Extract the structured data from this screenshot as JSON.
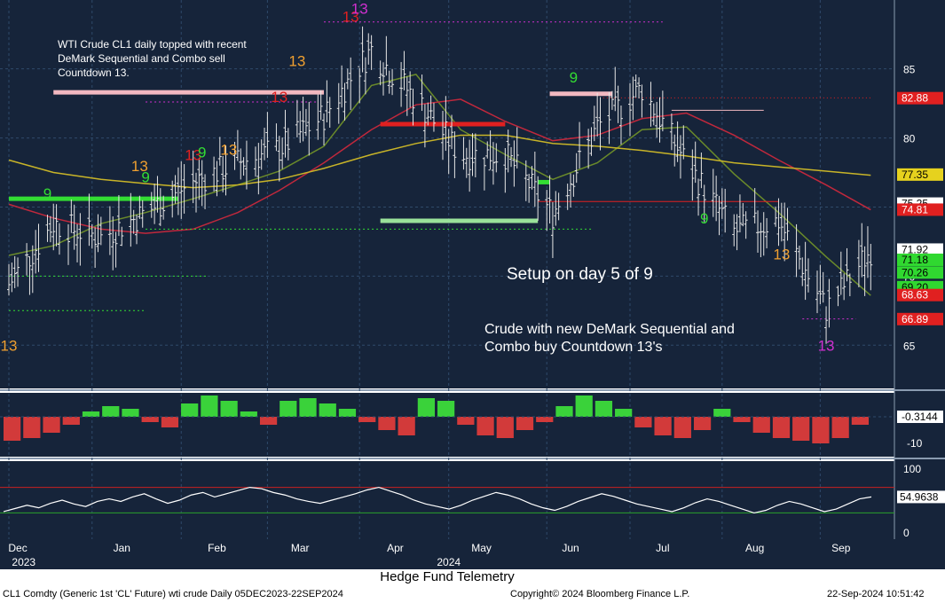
{
  "colors": {
    "panel_bg": "#16243a",
    "grid": "#2f4a6a",
    "price_bar": "#e6e6e6",
    "setup_buy": "#33dd33",
    "setup_sell": "#e02020",
    "countdown": "#f0a030",
    "magenta": "#d030d0",
    "ma_short": "#6a8a2a",
    "ma_mid": "#c0283c",
    "ma_long": "#c8b428",
    "osc_pos": "#3ad23a",
    "osc_neg": "#d23a3a",
    "rsi_line": "#ffffff",
    "rsi_top": "#c82020",
    "rsi_bottom": "#2aa02a"
  },
  "chart_data": [
    {
      "type": "candlestick",
      "title": "WTI Crude CL1 daily",
      "x_range": [
        "2023-12-05",
        "2024-09-22"
      ],
      "x_ticks": [
        "Dec",
        "Jan",
        "Feb",
        "Mar",
        "Apr",
        "May",
        "Jun",
        "Jul",
        "Aug",
        "Sep"
      ],
      "x_years": [
        "2023",
        "2024"
      ],
      "y_ticks": [
        65,
        70,
        75,
        80,
        85
      ],
      "ylim": [
        62.0,
        89.6
      ],
      "series": [
        {
          "name": "close",
          "x": [
            "2023-12-05",
            "2023-12-20",
            "2024-01-05",
            "2024-01-20",
            "2024-02-05",
            "2024-02-20",
            "2024-03-05",
            "2024-03-20",
            "2024-04-05",
            "2024-04-20",
            "2024-05-05",
            "2024-05-20",
            "2024-06-05",
            "2024-06-20",
            "2024-07-05",
            "2024-07-20",
            "2024-08-05",
            "2024-08-20",
            "2024-09-05",
            "2024-09-20"
          ],
          "values": [
            69.4,
            73.8,
            72.8,
            74.6,
            76.8,
            78.2,
            79.2,
            81.6,
            86.4,
            82.8,
            78.8,
            78.8,
            74.5,
            80.8,
            83.6,
            78.2,
            73.2,
            74.0,
            67.6,
            71.9
          ]
        }
      ],
      "price_labels": [
        {
          "value": 82.88,
          "label": "82.88",
          "color": "#e02020"
        },
        {
          "value": 77.35,
          "label": "77.35",
          "color": "#e6d21e"
        },
        {
          "value": 75.25,
          "label": "75.25",
          "color": "#ffffff"
        },
        {
          "value": 74.81,
          "label": "74.81",
          "color": "#e02020"
        },
        {
          "value": 71.92,
          "label": "71.92",
          "color": "#ffffff"
        },
        {
          "value": 71.18,
          "label": "71.18",
          "color": "#30d830"
        },
        {
          "value": 70.26,
          "label": "70.26",
          "color": "#30d830"
        },
        {
          "value": 69.2,
          "label": "69.20",
          "color": "#30d830"
        },
        {
          "value": 68.63,
          "label": "68.63",
          "color": "#e02020"
        },
        {
          "value": 66.89,
          "label": "66.89",
          "color": "#e02020"
        }
      ],
      "annotations": [
        "WTI Crude CL1 daily topped with recent",
        "DeMark Sequential and Combo sell",
        "Countdown 13.",
        "Setup on day 5 of 9",
        "Crude with new DeMark Sequential and",
        "Combo buy Countdown 13's"
      ],
      "demark_marks": [
        {
          "date": "2023-12-05",
          "value": 64.6,
          "text": "13",
          "color": "#f0a030"
        },
        {
          "date": "2023-12-18",
          "value": 75.6,
          "text": "9",
          "color": "#33dd33"
        },
        {
          "date": "2024-01-18",
          "value": 77.6,
          "text": "13",
          "color": "#f0a030"
        },
        {
          "date": "2024-01-20",
          "value": 76.8,
          "text": "9",
          "color": "#33dd33"
        },
        {
          "date": "2024-02-05",
          "value": 78.4,
          "text": "13",
          "color": "#e02020"
        },
        {
          "date": "2024-02-08",
          "value": 78.6,
          "text": "9",
          "color": "#33dd33"
        },
        {
          "date": "2024-02-17",
          "value": 78.8,
          "text": "13",
          "color": "#f0a030"
        },
        {
          "date": "2024-03-05",
          "value": 82.6,
          "text": "13",
          "color": "#e02020"
        },
        {
          "date": "2024-03-11",
          "value": 85.2,
          "text": "13",
          "color": "#f0a030"
        },
        {
          "date": "2024-03-29",
          "value": 88.4,
          "text": "13",
          "color": "#e02020"
        },
        {
          "date": "2024-04-01",
          "value": 89.0,
          "text": "13",
          "color": "#d030d0"
        },
        {
          "date": "2024-06-12",
          "value": 84.0,
          "text": "9",
          "color": "#33dd33"
        },
        {
          "date": "2024-07-26",
          "value": 73.8,
          "text": "9",
          "color": "#33dd33"
        },
        {
          "date": "2024-08-21",
          "value": 71.2,
          "text": "13",
          "color": "#f0a030"
        },
        {
          "date": "2024-09-05",
          "value": 64.6,
          "text": "13",
          "color": "#d030d0"
        }
      ],
      "ma": [
        {
          "name": "ma_short",
          "values": [
            71.5,
            72.2,
            73.8,
            74.6,
            75.6,
            76.6,
            77.6,
            79.4,
            83.8,
            84.6,
            80.6,
            78.8,
            77.0,
            78.2,
            80.6,
            80.8,
            77.4,
            74.6,
            71.4,
            68.6
          ]
        },
        {
          "name": "ma_mid",
          "values": [
            75.2,
            74.2,
            73.4,
            73.1,
            73.4,
            74.6,
            76.2,
            78.2,
            80.6,
            82.4,
            82.8,
            81.2,
            79.8,
            80.2,
            81.4,
            81.8,
            80.2,
            78.4,
            76.6,
            74.8
          ]
        },
        {
          "name": "ma_long",
          "values": [
            78.4,
            77.5,
            77.0,
            76.7,
            76.4,
            76.6,
            77.0,
            77.8,
            78.8,
            79.6,
            80.2,
            80.2,
            79.6,
            79.4,
            79.1,
            78.7,
            78.2,
            77.9,
            77.6,
            77.3
          ]
        }
      ]
    },
    {
      "type": "bar",
      "title": "",
      "ylabel": "",
      "y_ticks": [
        -10
      ],
      "last_label": "-0.3144",
      "values": [
        -9,
        -8,
        -6,
        -3,
        2,
        4,
        3,
        -2,
        -4,
        5,
        8,
        6,
        2,
        -3,
        6,
        7,
        5,
        3,
        -2,
        -5,
        -7,
        7,
        6,
        -3,
        -7,
        -8,
        -5,
        -2,
        4,
        8,
        6,
        3,
        -4,
        -7,
        -8,
        -5,
        3,
        -2,
        -6,
        -8,
        -9,
        -10,
        -8,
        -3
      ]
    },
    {
      "type": "line",
      "title": "",
      "ylabel": "",
      "y_ticks": [
        0,
        100
      ],
      "last_label": "54.9638",
      "values": [
        32,
        37,
        42,
        38,
        45,
        50,
        44,
        40,
        48,
        52,
        48,
        55,
        60,
        52,
        45,
        50,
        58,
        62,
        55,
        60,
        65,
        70,
        68,
        62,
        58,
        52,
        48,
        45,
        50,
        55,
        60,
        66,
        70,
        64,
        58,
        50,
        44,
        40,
        36,
        42,
        50,
        56,
        62,
        58,
        52,
        44,
        38,
        34,
        40,
        48,
        54,
        60,
        56,
        50,
        44,
        40,
        36,
        32,
        38,
        46,
        52,
        48,
        42,
        36,
        30,
        34,
        42,
        48,
        44,
        38,
        32,
        36,
        44,
        52,
        55
      ]
    }
  ],
  "axis": {
    "months": [
      "Dec",
      "Jan",
      "Feb",
      "Mar",
      "Apr",
      "May",
      "Jun",
      "Jul",
      "Aug",
      "Sep"
    ],
    "years": [
      "2023",
      "2024"
    ]
  },
  "brand": "Hedge Fund Telemetry",
  "footer": {
    "left": "CL1 Comdty (Generic 1st 'CL' Future) wti crude  Daily 05DEC2023-22SEP2024",
    "center": "Copyright© 2024 Bloomberg Finance L.P.",
    "right": "22-Sep-2024 10:51:42"
  }
}
